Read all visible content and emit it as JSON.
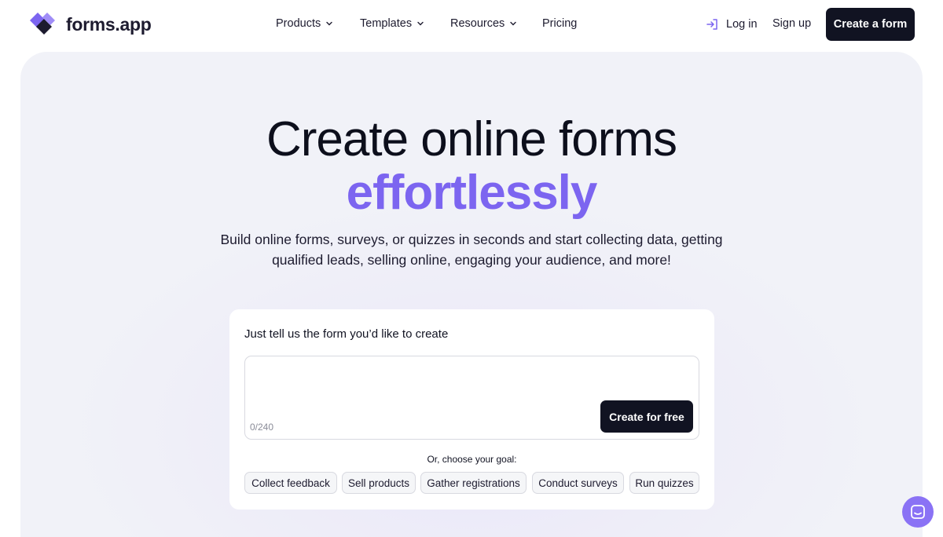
{
  "brand": {
    "name": "forms.app"
  },
  "nav": {
    "products": "Products",
    "templates": "Templates",
    "resources": "Resources",
    "pricing": "Pricing",
    "login": "Log in",
    "signup": "Sign up",
    "create_form": "Create a form"
  },
  "hero": {
    "title_line1": "Create online forms",
    "title_line2": "effortlessly",
    "subtitle_line1": "Build online forms, surveys, or quizzes in seconds and start collecting data, getting",
    "subtitle_line2": "qualified leads, selling online, engaging your audience, and more!"
  },
  "prompt_card": {
    "title": "Just tell us the form you’d like to create",
    "input_value": "",
    "counter": "0/240",
    "submit_label": "Create for free",
    "goal_label": "Or, choose your goal:",
    "goals": [
      "Collect feedback",
      "Sell products",
      "Gather registrations",
      "Conduct surveys",
      "Run quizzes"
    ]
  },
  "colors": {
    "accent": "#7c65f0",
    "dark": "#111322",
    "hero_bg": "#f1f2f8"
  },
  "icons": {
    "logo": "forms-app-logo-icon",
    "login": "login-arrow-icon",
    "chat": "chat-icon",
    "dropdown": "chevron-down-icon"
  }
}
